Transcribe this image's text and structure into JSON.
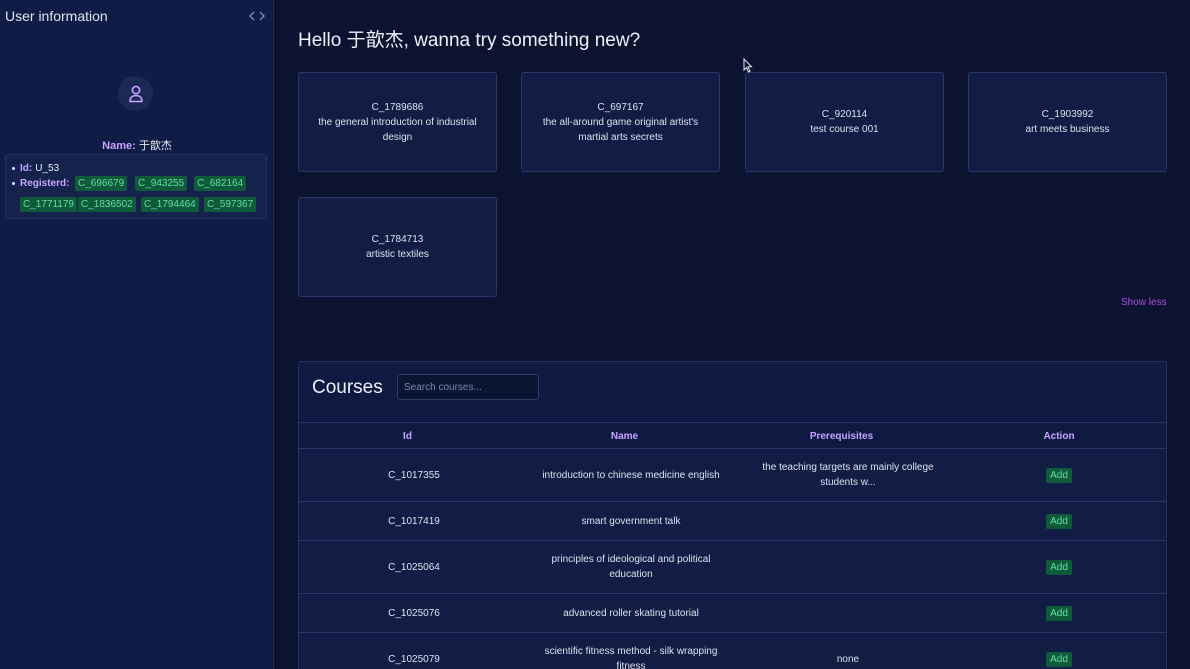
{
  "sidebar": {
    "title": "User information",
    "name_label": "Name:",
    "name_value": "于歆杰",
    "id_label": "Id:",
    "id_value": "U_53",
    "registered_label": "Registerd:",
    "registered": [
      "C_696679",
      "C_943255",
      "C_682164",
      "C_1771179",
      "C_1836502",
      "C_1794464",
      "C_597367"
    ]
  },
  "main": {
    "greeting": "Hello 于歆杰, wanna try something new?",
    "recommended": [
      {
        "id": "C_1789686",
        "name": "the general introduction of industrial design"
      },
      {
        "id": "C_697167",
        "name": "the all-around game original artist's martial arts secrets"
      },
      {
        "id": "C_920114",
        "name": "test course 001"
      },
      {
        "id": "C_1903992",
        "name": "art meets business"
      },
      {
        "id": "C_1784713",
        "name": "artistic textiles"
      }
    ],
    "show_less": "Show less"
  },
  "courses": {
    "title": "Courses",
    "search_placeholder": "Search courses...",
    "columns": [
      "Id",
      "Name",
      "Prerequisites",
      "Action"
    ],
    "rows": [
      {
        "id": "C_1017355",
        "name": "introduction to chinese medicine english",
        "prereq": "the teaching targets are mainly college students w...",
        "action": "Add"
      },
      {
        "id": "C_1017419",
        "name": "smart government talk",
        "prereq": "",
        "action": "Add"
      },
      {
        "id": "C_1025064",
        "name": "principles of ideological and political education",
        "prereq": "",
        "action": "Add"
      },
      {
        "id": "C_1025076",
        "name": "advanced roller skating tutorial",
        "prereq": "",
        "action": "Add"
      },
      {
        "id": "C_1025079",
        "name": "scientific fitness method - silk wrapping fitness",
        "prereq": "none",
        "action": "Add"
      }
    ]
  },
  "colors": {
    "background": "#0b1330",
    "accent_purple": "#c6a4ff",
    "chip_bg": "#0f5a3a",
    "chip_text": "#5ee0a0",
    "link": "#b24ae6"
  },
  "icons": {
    "collapse": "chevron-left-right-icon",
    "avatar": "user-icon"
  }
}
